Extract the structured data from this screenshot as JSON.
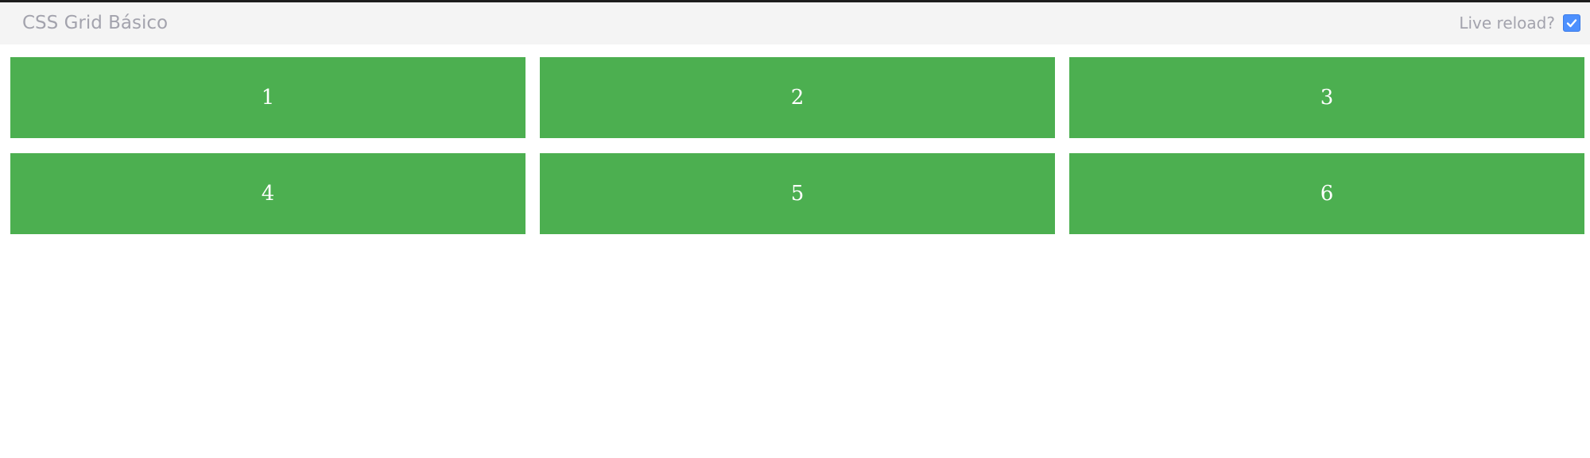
{
  "header": {
    "title": "CSS Grid Básico",
    "live_reload_label": "Live reload?",
    "live_reload_checked": true
  },
  "grid": {
    "color": "#4caf50",
    "items": [
      "1",
      "2",
      "3",
      "4",
      "5",
      "6"
    ]
  }
}
